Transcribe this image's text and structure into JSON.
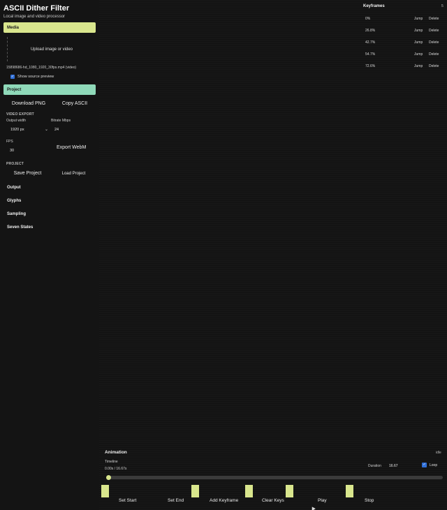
{
  "app": {
    "title": "ASCII Dither Filter",
    "subtitle": "Local image and video processor"
  },
  "media": {
    "header": "Media",
    "upload_label": "Upload image or video",
    "file_name": "15898686-hd_1080_1920_30fps.mp4 (video)",
    "show_source_label": "Show source preview",
    "show_source_checked": true
  },
  "project": {
    "header": "Project",
    "download_png": "Download PNG",
    "copy_ascii": "Copy ASCII",
    "video_export_label": "VIDEO EXPORT",
    "output_width_label": "Output width",
    "output_width_value": "1920 px",
    "bitrate_label": "Bitrate Mbps",
    "bitrate_value": "24",
    "fps_label": "FPS",
    "fps_value": "30",
    "export_webm": "Export WebM",
    "project_label": "PROJECT",
    "save_project": "Save Project",
    "load_project": "Load Project"
  },
  "sections": {
    "output": "Output",
    "glyphs": "Glyphs",
    "sampling": "Sampling",
    "seven_states": "Seven States"
  },
  "keyframes": {
    "title": "Keyframes",
    "count": "5",
    "jump_label": "Jump",
    "delete_label": "Delete",
    "items": [
      {
        "pct": "0%"
      },
      {
        "pct": "26.8%"
      },
      {
        "pct": "42.7%"
      },
      {
        "pct": "54.7%"
      },
      {
        "pct": "72.6%"
      }
    ]
  },
  "animation": {
    "title": "Animation",
    "status": "idle",
    "timeline_label": "Timeline",
    "time_readout": "0.00s / 16.67s",
    "progress": 0,
    "duration_label": "Duration",
    "duration_value": "16.67",
    "loop_label": "Loop",
    "loop_checked": true,
    "buttons": {
      "set_start": "Set Start",
      "set_end": "Set End",
      "add_keyframe": "Add Keyframe",
      "clear_keys": "Clear Keys",
      "play": "Play",
      "stop": "Stop"
    }
  },
  "colors": {
    "media_header": "#d9e68d",
    "project_header": "#8fd9b9",
    "accent": "#d9e68d",
    "checkbox": "#2f6fd8",
    "background": "#151515"
  }
}
